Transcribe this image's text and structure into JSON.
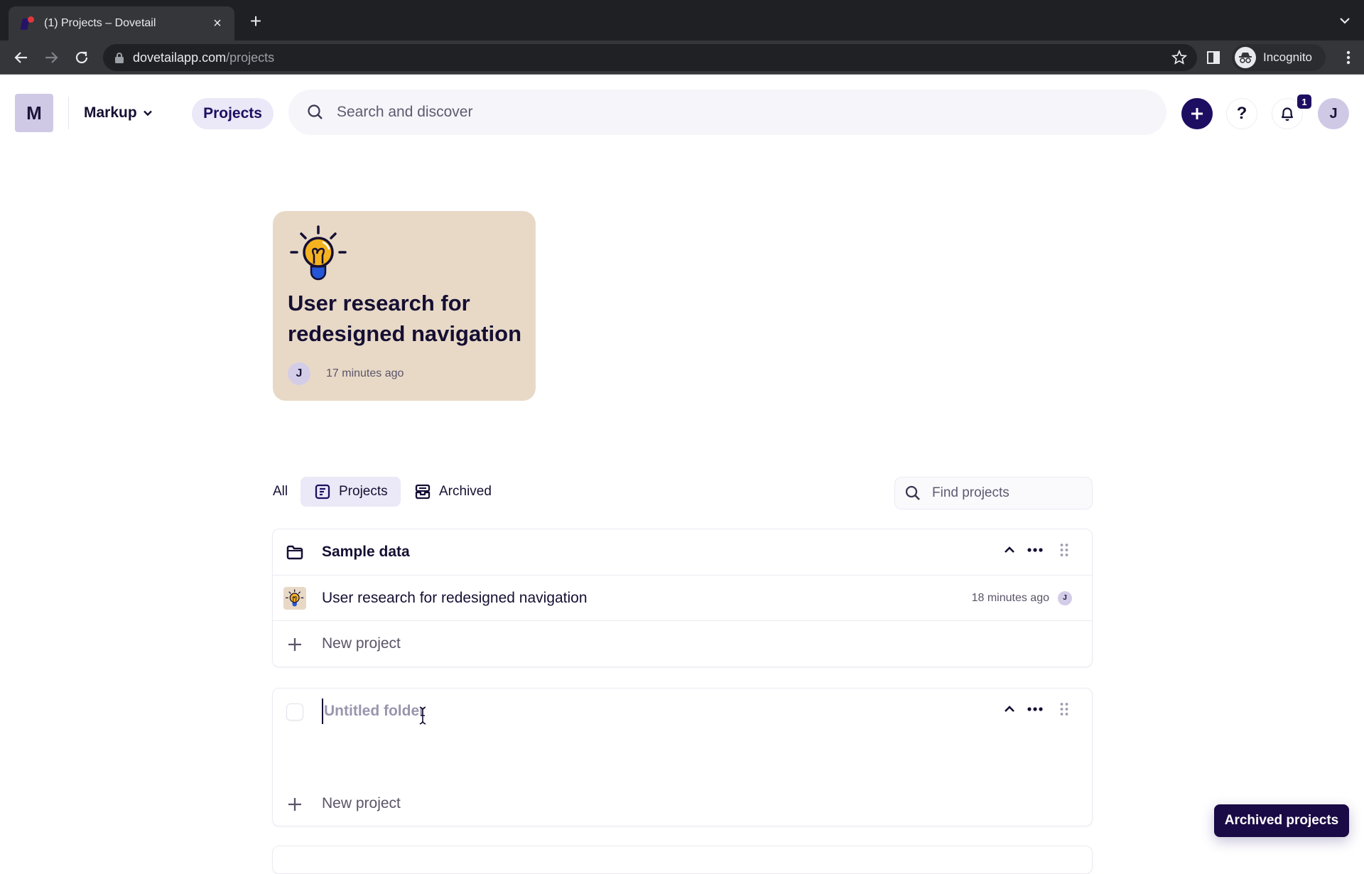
{
  "browser": {
    "tab_title": "(1) Projects – Dovetail",
    "url_host": "dovetailapp.com",
    "url_path": "/projects",
    "profile_label": "Incognito"
  },
  "header": {
    "workspace_initial": "M",
    "workspace_name": "Markup",
    "nav_projects_label": "Projects",
    "search_placeholder": "Search and discover",
    "help_label": "?",
    "notification_count": "1",
    "user_initial": "J",
    "accent_color": "#1e0e62"
  },
  "featured_project": {
    "title": "User research for redesigned navigation",
    "owner_initial": "J",
    "updated": "17 minutes ago",
    "icon": "lightbulb-icon",
    "card_color": "#e8d9c7"
  },
  "filters": {
    "tabs": [
      {
        "label": "All",
        "active": false
      },
      {
        "label": "Projects",
        "active": true,
        "icon": "project-icon"
      },
      {
        "label": "Archived",
        "active": false,
        "icon": "archive-icon"
      }
    ],
    "find_placeholder": "Find projects"
  },
  "folders": [
    {
      "name": "Sample data",
      "icon": "folder-icon",
      "projects": [
        {
          "title": "User research for redesigned navigation",
          "updated": "18 minutes ago",
          "owner_initial": "J",
          "icon": "lightbulb-icon"
        }
      ],
      "new_project_label": "New project"
    },
    {
      "name": "",
      "name_placeholder": "Untitled folder",
      "editing": true,
      "projects": [],
      "new_project_label": "New project"
    }
  ],
  "toast": {
    "label": "Archived projects"
  }
}
